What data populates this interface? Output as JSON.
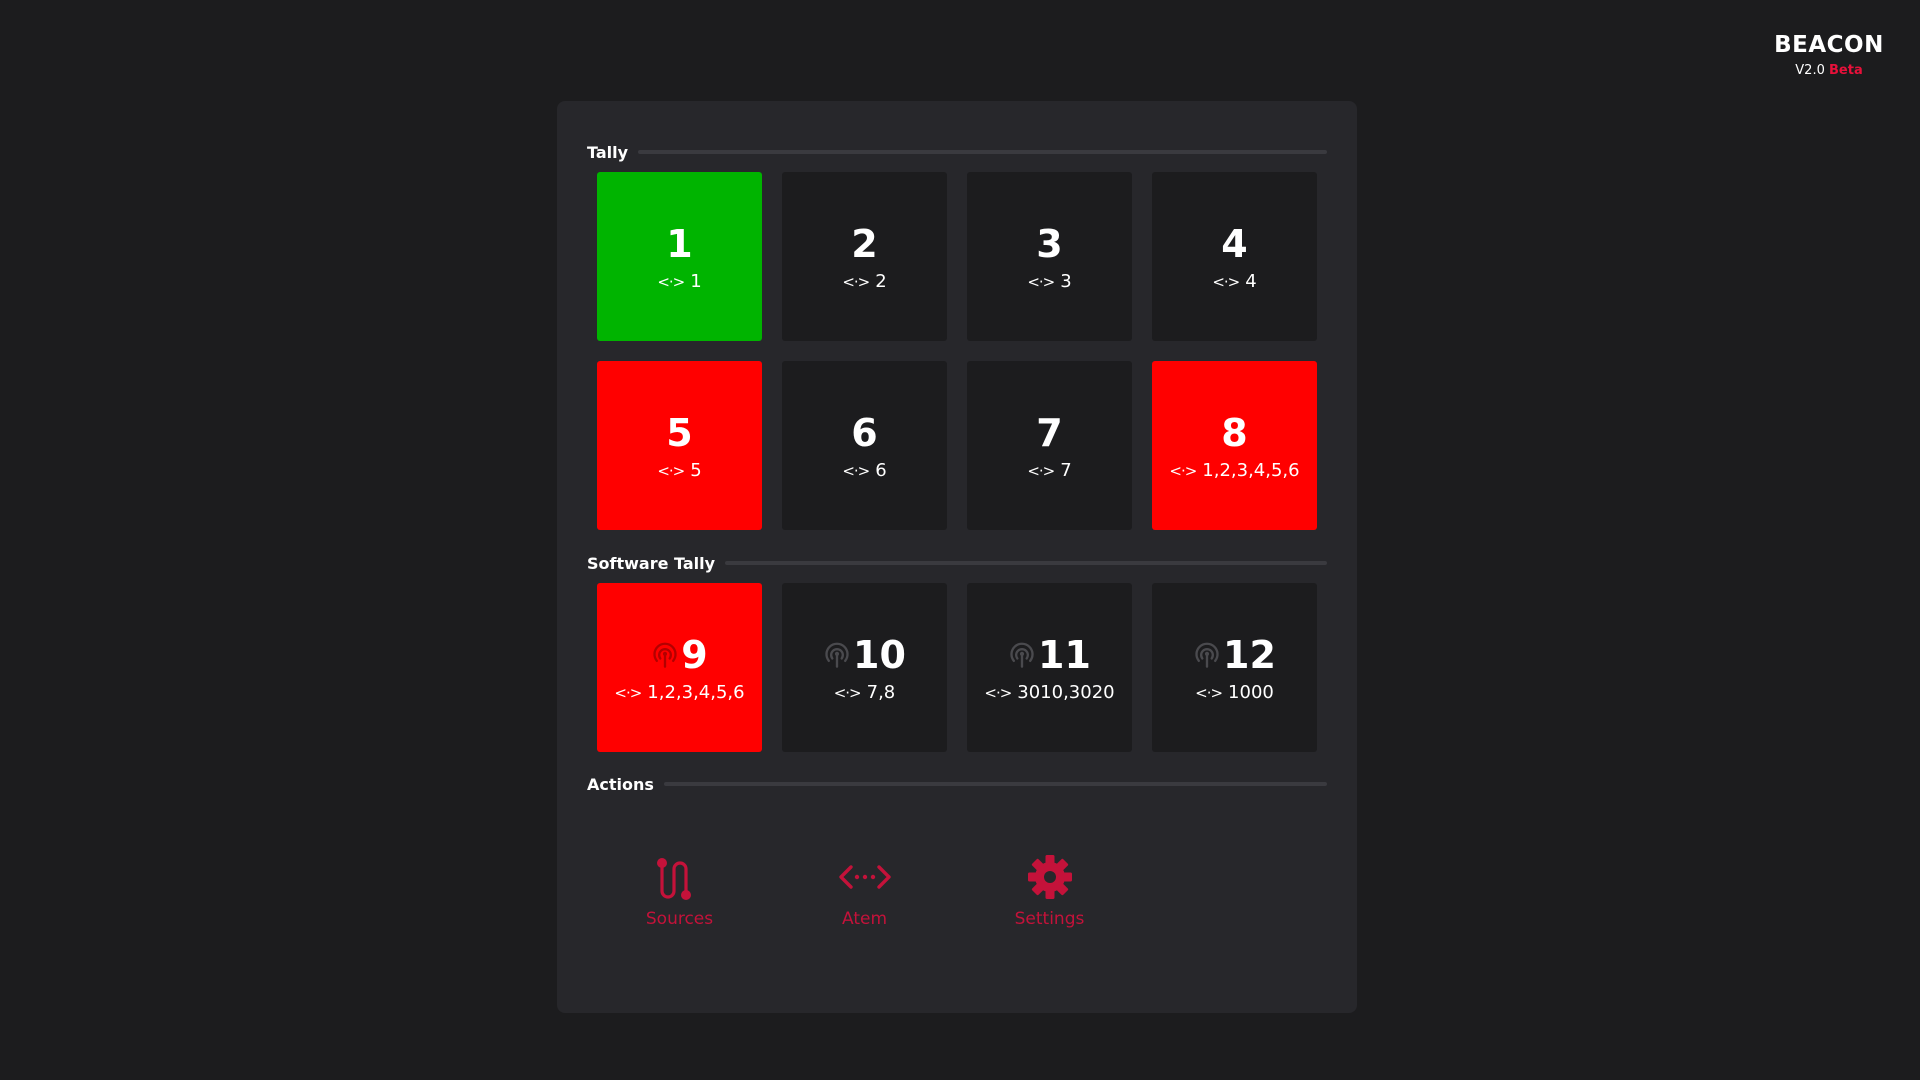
{
  "brand": {
    "name": "BEACON",
    "version": "V2.0",
    "badge": "Beta"
  },
  "colors": {
    "accent": "#c4123a",
    "program": "#ff0000",
    "preview": "#00b400",
    "tile": "#1c1c1e",
    "panel": "#27272b"
  },
  "sections": {
    "tally": "Tally",
    "software_tally": "Software Tally",
    "actions": "Actions"
  },
  "tally": [
    {
      "num": "1",
      "map": "1",
      "state": "green"
    },
    {
      "num": "2",
      "map": "2",
      "state": "off"
    },
    {
      "num": "3",
      "map": "3",
      "state": "off"
    },
    {
      "num": "4",
      "map": "4",
      "state": "off"
    },
    {
      "num": "5",
      "map": "5",
      "state": "red"
    },
    {
      "num": "6",
      "map": "6",
      "state": "off"
    },
    {
      "num": "7",
      "map": "7",
      "state": "off"
    },
    {
      "num": "8",
      "map": "1,2,3,4,5,6",
      "state": "red"
    }
  ],
  "software_tally": [
    {
      "num": "9",
      "map": "1,2,3,4,5,6",
      "state": "red",
      "icon": "broadcast-icon"
    },
    {
      "num": "10",
      "map": "7,8",
      "state": "off",
      "icon": "broadcast-icon"
    },
    {
      "num": "11",
      "map": "3010,3020",
      "state": "off",
      "icon": "broadcast-icon"
    },
    {
      "num": "12",
      "map": "1000",
      "state": "off",
      "icon": "broadcast-icon"
    }
  ],
  "actions": [
    {
      "label": "Sources",
      "icon": "route-icon"
    },
    {
      "label": "Atem",
      "icon": "code-arrows-icon"
    },
    {
      "label": "Settings",
      "icon": "gear-icon"
    }
  ],
  "map_icon": "left-right-arrow-icon"
}
